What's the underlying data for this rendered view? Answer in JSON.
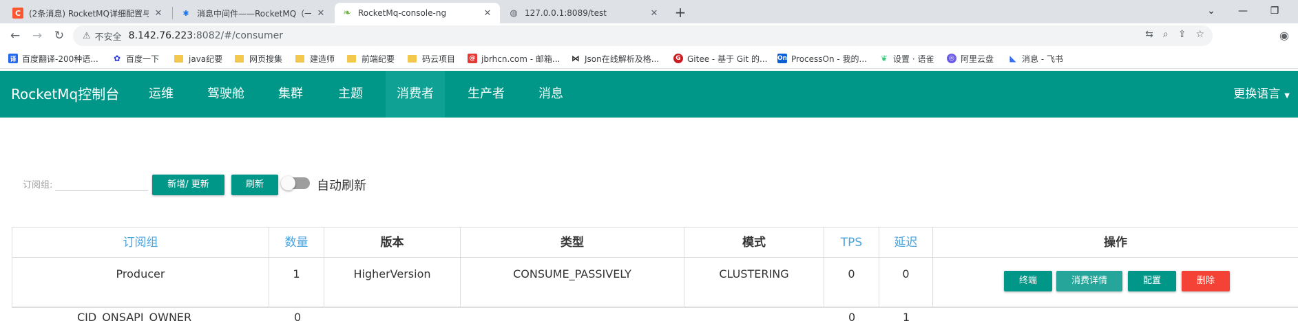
{
  "browser": {
    "tabs": [
      {
        "title": "(2条消息) RocketMQ详细配置与",
        "favicon": "csdn-icon",
        "active": false
      },
      {
        "title": "消息中间件——RocketMQ（一）",
        "favicon": "zhihu-icon",
        "active": false
      },
      {
        "title": "RocketMq-console-ng",
        "favicon": "leaf-icon",
        "active": true
      },
      {
        "title": "127.0.0.1:8089/test",
        "favicon": "globe-icon",
        "active": false
      }
    ],
    "address": {
      "security_label": "不安全",
      "host": "8.142.76.223",
      "rest": ":8082/#/consumer"
    },
    "bookmarks": [
      {
        "label": "百度翻译-200种语...",
        "icon": "translate-icon",
        "color": "#2468f2"
      },
      {
        "label": "百度一下",
        "icon": "baidu-paw-icon",
        "color": "#2932e1"
      },
      {
        "label": "java纪要",
        "icon": "folder-icon",
        "color": "#f2c94c"
      },
      {
        "label": "网页搜集",
        "icon": "folder-icon",
        "color": "#f2c94c"
      },
      {
        "label": "建造师",
        "icon": "folder-icon",
        "color": "#f2c94c"
      },
      {
        "label": "前端纪要",
        "icon": "folder-icon",
        "color": "#f2c94c"
      },
      {
        "label": "码云项目",
        "icon": "folder-icon",
        "color": "#f2c94c"
      },
      {
        "label": "jbrhcn.com - 邮箱...",
        "icon": "mail-icon",
        "color": "#e53935"
      },
      {
        "label": "Json在线解析及格...",
        "icon": "json-icon",
        "color": "#222222"
      },
      {
        "label": "Gitee - 基于 Git 的...",
        "icon": "gitee-icon",
        "color": "#c71d23"
      },
      {
        "label": "ProcessOn - 我的...",
        "icon": "processon-icon",
        "color": "#0d5fd8"
      },
      {
        "label": "设置 · 语雀",
        "icon": "yuque-icon",
        "color": "#31cc79"
      },
      {
        "label": "阿里云盘",
        "icon": "aliyun-drive-icon",
        "color": "#6c5ce7"
      },
      {
        "label": "消息 - 飞书",
        "icon": "feishu-icon",
        "color": "#3370ff"
      }
    ]
  },
  "app": {
    "brand": "RocketMq控制台",
    "nav": [
      "运维",
      "驾驶舱",
      "集群",
      "主题",
      "消费者",
      "生产者",
      "消息"
    ],
    "active_nav": "消费者",
    "language_label": "更换语言",
    "accent": "#009688"
  },
  "filter": {
    "label": "订阅组:",
    "value": "",
    "add_update_label": "新增/ 更新",
    "refresh_label": "刷新",
    "auto_refresh_label": "自动刷新",
    "auto_refresh_on": false
  },
  "table": {
    "headers": [
      "订阅组",
      "数量",
      "版本",
      "类型",
      "模式",
      "TPS",
      "延迟",
      "操作"
    ],
    "rows": [
      {
        "group": "Producer",
        "count": "1",
        "version": "HigherVersion",
        "type": "CONSUME_PASSIVELY",
        "mode": "CLUSTERING",
        "tps": "0",
        "delay": "0",
        "actions": [
          "终端",
          "消费详情",
          "配置",
          "删除"
        ]
      }
    ],
    "next_row_partial": {
      "group": "CID_ONSAPI_OWNER",
      "count": "0",
      "tps": "0",
      "delay": "1"
    }
  }
}
